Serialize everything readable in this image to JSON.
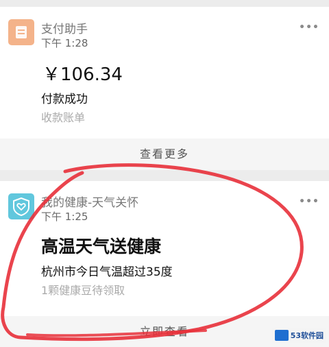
{
  "notifications": [
    {
      "app_name": "支付助手",
      "time": "下午 1:28",
      "amount": "￥106.34",
      "status": "付款成功",
      "subtext": "收款账单",
      "more": "•••",
      "footer": "查看更多",
      "icon": "receipt-icon",
      "icon_color": "#f4b38a"
    },
    {
      "app_name": "我的健康-天气关怀",
      "time": "下午 1:25",
      "headline": "高温天气送健康",
      "detail": "杭州市今日气温超过35度",
      "subtext": "1颗健康豆待领取",
      "more": "•••",
      "footer": "立即查看",
      "icon": "heart-shield-icon",
      "icon_color": "#61c7dd"
    }
  ],
  "annotation_color": "#e8303a",
  "watermark": {
    "text": "53软件园"
  }
}
